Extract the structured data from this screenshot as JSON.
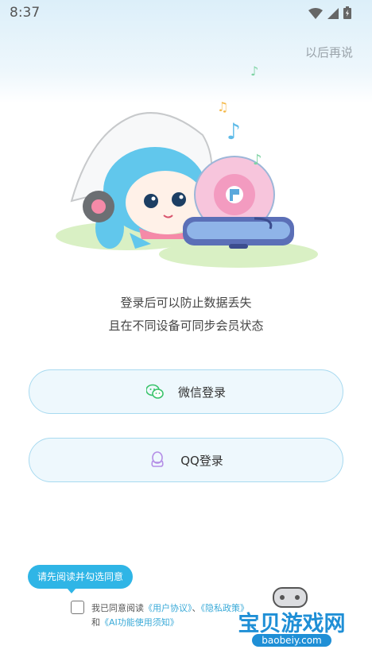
{
  "status_bar": {
    "time": "8:37"
  },
  "header": {
    "skip_label": "以后再说"
  },
  "tagline": {
    "line1": "登录后可以防止数据丢失",
    "line2": "且在不同设备可同步会员状态"
  },
  "buttons": {
    "wechat_label": "微信登录",
    "qq_label": "QQ登录"
  },
  "agreement": {
    "tooltip": "请先阅读并勾选同意",
    "prefix": "我已同意阅读",
    "user_agreement": "《用户协议》",
    "separator": "、",
    "privacy_policy": "《隐私政策》",
    "and": "和",
    "ai_notice": "《AI功能使用须知》"
  },
  "watermark": {
    "title": "宝贝游戏网",
    "url": "baobeiy.com"
  },
  "icons": [
    "wifi-icon",
    "signal-icon",
    "battery-icon",
    "wechat-icon",
    "qq-icon"
  ],
  "colors": {
    "accent": "#2fb5e6",
    "link": "#3aaad8",
    "button_border": "#a8daf0",
    "button_bg": "#eef8fd"
  }
}
